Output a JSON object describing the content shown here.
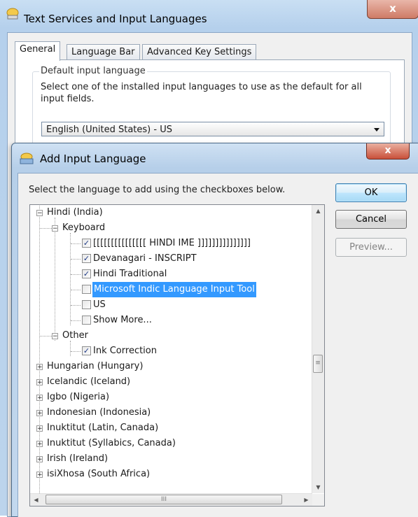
{
  "main_window": {
    "title": "Text Services and Input Languages",
    "close_symbol": "x",
    "tabs": [
      {
        "label": "General",
        "active": true
      },
      {
        "label": "Language Bar",
        "active": false
      },
      {
        "label": "Advanced Key Settings",
        "active": false
      }
    ],
    "group_title": "Default input language",
    "group_description": "Select one of the installed input languages to use as the default for all input fields.",
    "default_language": "English (United States) - US"
  },
  "dialog": {
    "title": "Add Input Language",
    "close_symbol": "x",
    "instruction": "Select the language to add using the checkboxes below.",
    "buttons": {
      "ok": "OK",
      "cancel": "Cancel",
      "preview": "Preview..."
    },
    "tree": [
      {
        "label": "Hindi (India)",
        "expander": "−"
      },
      {
        "label": "Keyboard",
        "expander": "−"
      },
      {
        "label": "[[[[[[[[[[[[[[[ HINDI IME ]]]]]]]]]]]]]]]",
        "checked": true
      },
      {
        "label": "Devanagari - INSCRIPT",
        "checked": true
      },
      {
        "label": "Hindi Traditional",
        "checked": true
      },
      {
        "label": "Microsoft Indic Language Input Tool",
        "checked": false,
        "selected": true
      },
      {
        "label": "US",
        "checked": false
      },
      {
        "label": "Show More...",
        "checked": false
      },
      {
        "label": "Other",
        "expander": "−"
      },
      {
        "label": "Ink Correction",
        "checked": true
      },
      {
        "label": "Hungarian (Hungary)",
        "expander": "+"
      },
      {
        "label": "Icelandic (Iceland)",
        "expander": "+"
      },
      {
        "label": "Igbo (Nigeria)",
        "expander": "+"
      },
      {
        "label": "Indonesian (Indonesia)",
        "expander": "+"
      },
      {
        "label": "Inuktitut (Latin, Canada)",
        "expander": "+"
      },
      {
        "label": "Inuktitut (Syllabics, Canada)",
        "expander": "+"
      },
      {
        "label": "Irish (Ireland)",
        "expander": "+"
      },
      {
        "label": "isiXhosa (South Africa)",
        "expander": "+"
      }
    ],
    "check_mark": "✓",
    "scroll_glyphs": {
      "up": "▲",
      "down": "▼",
      "left": "◀",
      "right": "▶",
      "thumb_v": "≡",
      "thumb_h": "III"
    }
  },
  "colors": {
    "selection": "#3399ff",
    "close_button": "#c9503a",
    "title_bar": "#b6cfe9"
  }
}
